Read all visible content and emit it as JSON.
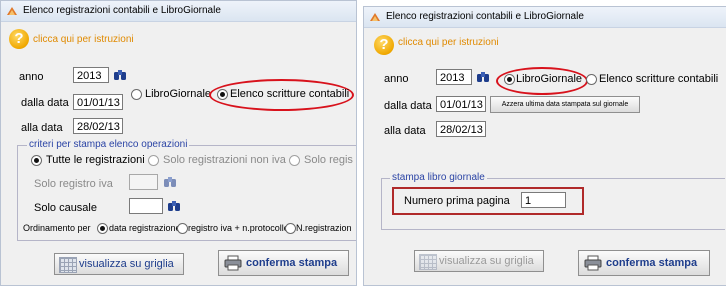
{
  "left": {
    "title": "Elenco registrazioni contabili e LibroGiornale",
    "help_text": "clicca qui per istruzioni",
    "anno_label": "anno",
    "anno_value": "2013",
    "dalla_label": "dalla data",
    "dalla_value": "01/01/13",
    "alla_label": "alla data",
    "alla_value": "28/02/13",
    "radio_libro": "LibroGiornale",
    "radio_elenco": "Elenco scritture contabili",
    "group_title": "criteri per stampa elenco operazioni",
    "opt_tutte": "Tutte le registrazioni",
    "opt_non_iva": "Solo registrazioni non iva",
    "opt_solo_regis": "Solo regis",
    "solo_registro_iva": "Solo registro iva",
    "solo_causale": "Solo causale",
    "ordinamento_label": "Ordinamento per",
    "ord_data": "data registrazione",
    "ord_registro": "registro iva + n.protocollo",
    "ord_nreg": "N.registrazion",
    "btn_griglia": "visualizza su griglia",
    "btn_conferma": "conferma stampa"
  },
  "right": {
    "title": "Elenco registrazioni contabili e LibroGiornale",
    "help_text": "clicca qui per istruzioni",
    "anno_label": "anno",
    "anno_value": "2013",
    "dalla_label": "dalla data",
    "dalla_value": "01/01/13",
    "alla_label": "alla data",
    "alla_value": "28/02/13",
    "radio_libro": "LibroGiornale",
    "radio_elenco": "Elenco scritture contabili",
    "btn_azzera": "Azzera ultima data stampata sul giornale",
    "group_title": "stampa libro giornale",
    "numero_label": "Numero prima pagina",
    "numero_value": "1",
    "btn_griglia": "visualizza su griglia",
    "btn_conferma": "conferma stampa"
  },
  "colors": {
    "accent_red": "#d8121c",
    "group_title": "#2b44a5",
    "help_orange": "#e08a00"
  },
  "icons": [
    "app-icon",
    "help-icon",
    "binoculars-icon",
    "grid-icon",
    "printer-icon"
  ]
}
